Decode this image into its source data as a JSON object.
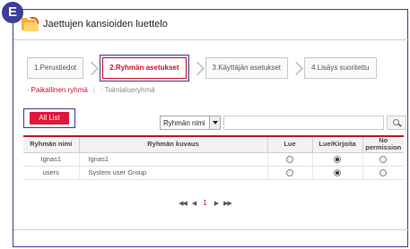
{
  "badge": "E",
  "title": "Jaettujen kansioiden luettelo",
  "steps": [
    {
      "label": "1.Perustiedot"
    },
    {
      "label": "2.Ryhmän asetukset"
    },
    {
      "label": "3.Käyttäjän asetukset"
    },
    {
      "label": "4.Lisäys suoritettu"
    }
  ],
  "subtabs": {
    "active": "Paikallinen ryhmä",
    "other": "Toimialueryhmä"
  },
  "all_list_button": "All List",
  "search": {
    "selected": "Ryhmän nimi",
    "value": ""
  },
  "table": {
    "headers": [
      "Ryhmän nimi",
      "Ryhmän kuvaus",
      "Lue",
      "Lue/Kirjoita",
      "No permission"
    ],
    "rows": [
      {
        "name": "Ignas1",
        "description": "Ignas1",
        "selected": "rw"
      },
      {
        "name": "users",
        "description": "System user Group",
        "selected": "rw"
      }
    ]
  },
  "pager": {
    "first": "◀◀",
    "prev": "◀",
    "page": "1",
    "next": "▶",
    "last": "▶▶"
  },
  "colors": {
    "accent": "#c8102e",
    "button": "#e0163a",
    "highlight_box": "#3b3f96"
  }
}
